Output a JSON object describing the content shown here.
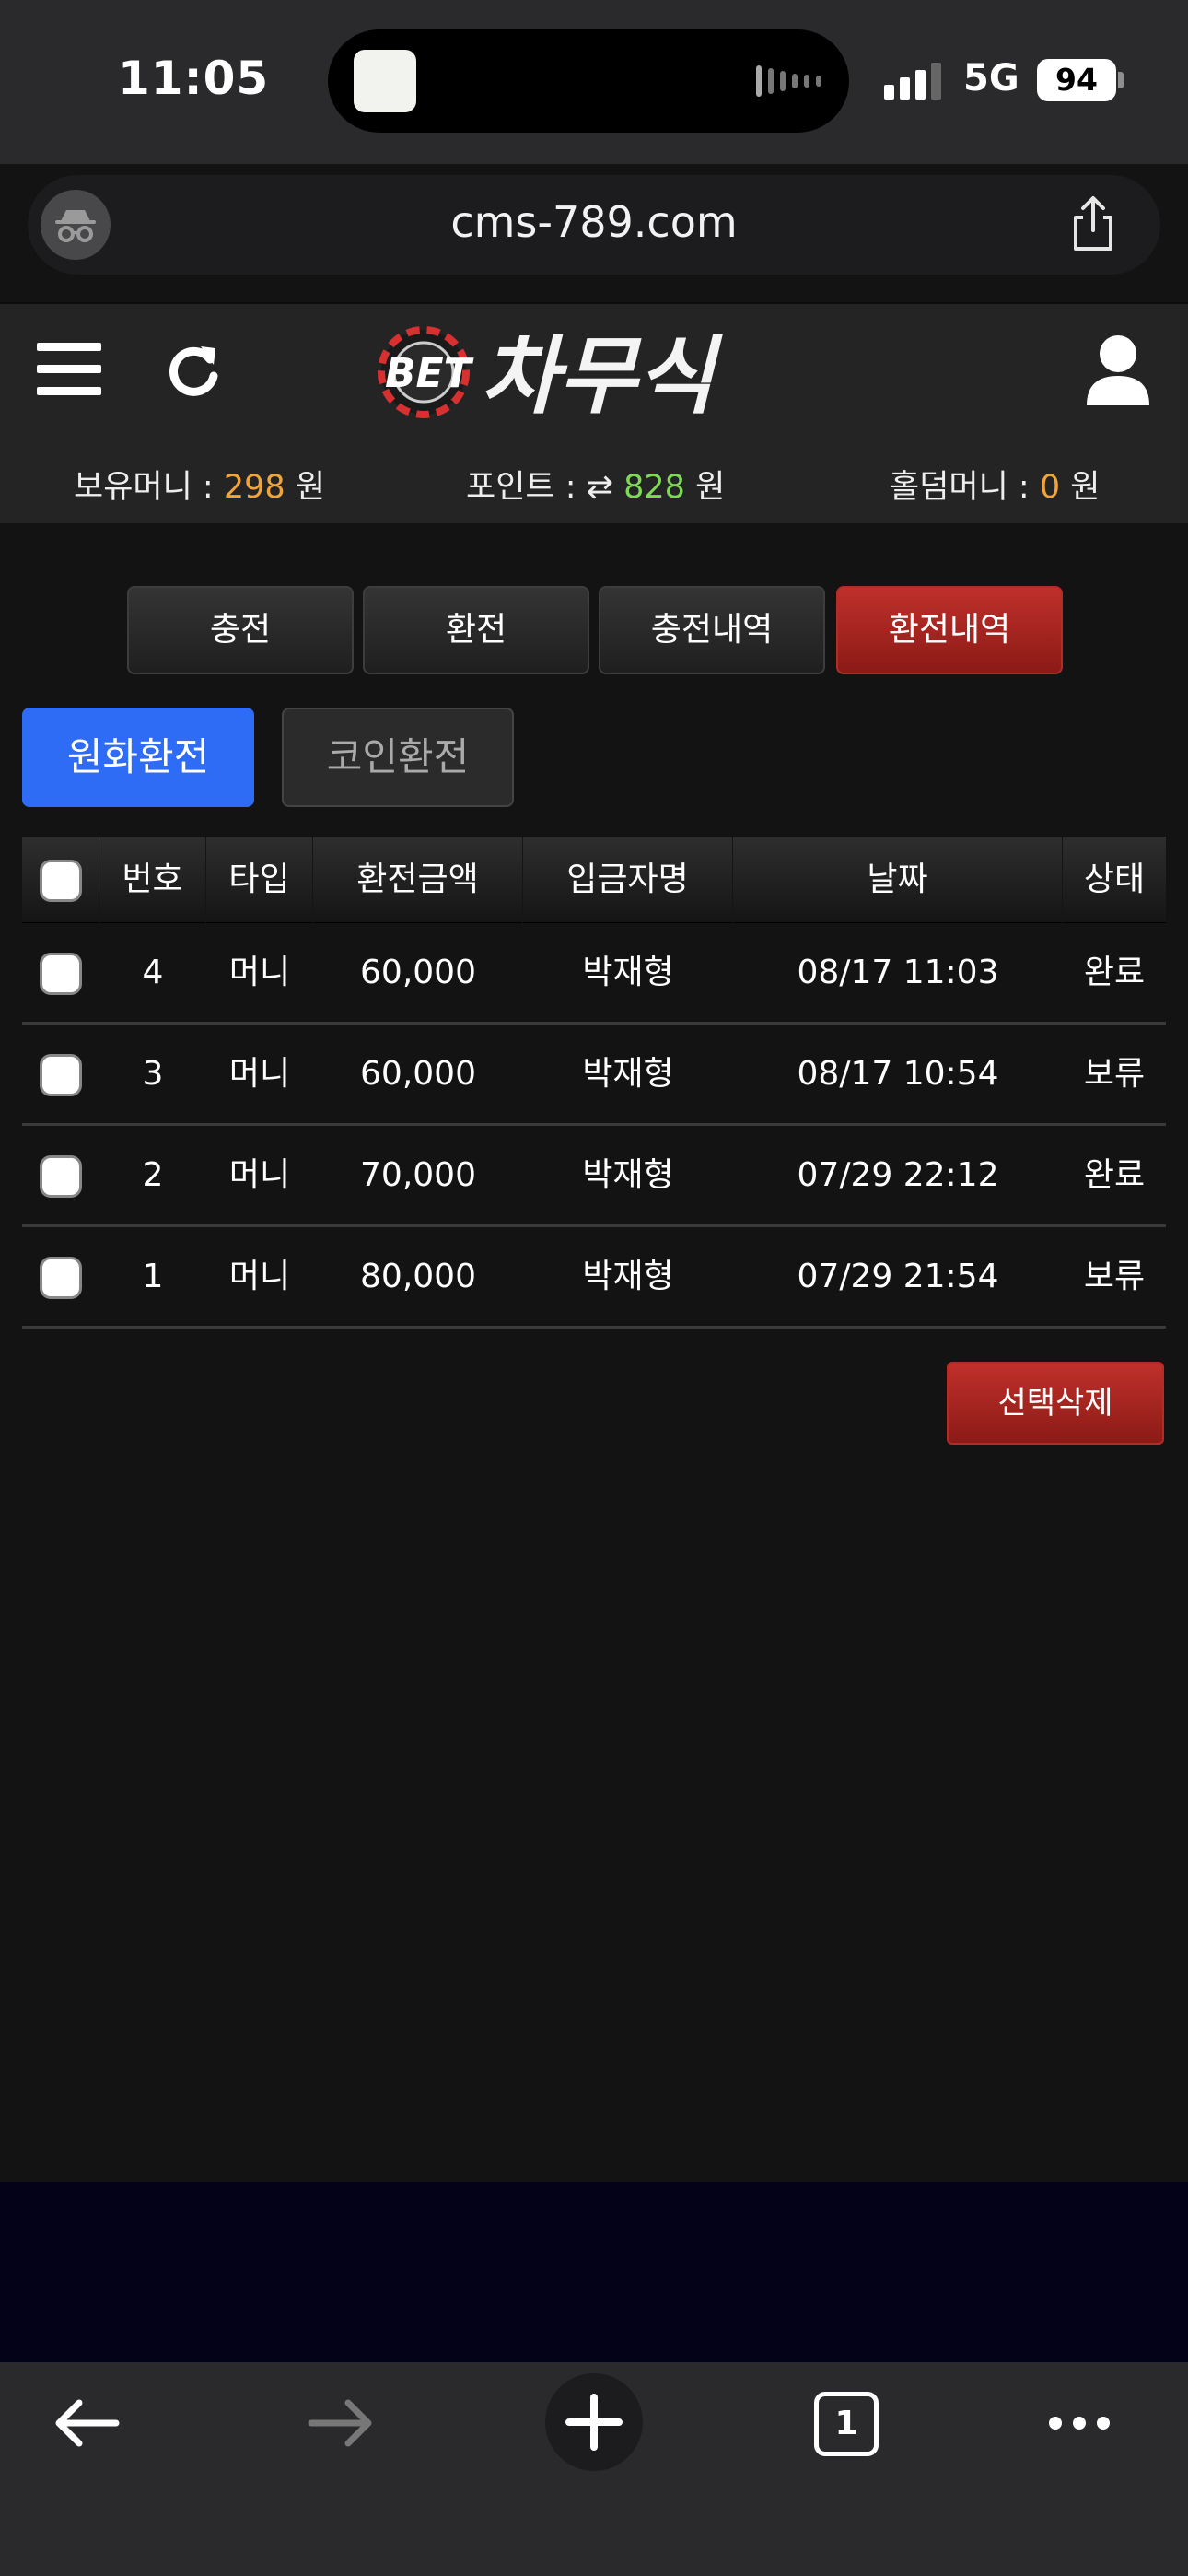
{
  "status": {
    "time": "11:05",
    "network": "5G",
    "battery": "94"
  },
  "browser": {
    "url": "cms-789.com",
    "tab_count": "1"
  },
  "header": {
    "logo_bet": "BET",
    "logo_name": "차무식",
    "balances": {
      "money_label": "보유머니 :",
      "money_value": "298",
      "money_unit": "원",
      "point_label": "포인트 :",
      "point_value": "828",
      "point_unit": "원",
      "holdem_label": "홀덤머니 :",
      "holdem_value": "0",
      "holdem_unit": "원"
    }
  },
  "nav_tabs": [
    "충전",
    "환전",
    "충전내역",
    "환전내역"
  ],
  "sub_tabs": [
    "원화환전",
    "코인환전"
  ],
  "table": {
    "headers": [
      "번호",
      "타입",
      "환전금액",
      "입금자명",
      "날짜",
      "상태"
    ],
    "rows": [
      {
        "no": "4",
        "type": "머니",
        "amount": "60,000",
        "name": "박재형",
        "date": "08/17 11:03",
        "status": "완료"
      },
      {
        "no": "3",
        "type": "머니",
        "amount": "60,000",
        "name": "박재형",
        "date": "08/17 10:54",
        "status": "보류"
      },
      {
        "no": "2",
        "type": "머니",
        "amount": "70,000",
        "name": "박재형",
        "date": "07/29 22:12",
        "status": "완료"
      },
      {
        "no": "1",
        "type": "머니",
        "amount": "80,000",
        "name": "박재형",
        "date": "07/29 21:54",
        "status": "보류"
      }
    ]
  },
  "delete_button": "선택삭제",
  "colors": {
    "accent_red": "#b32c26",
    "accent_blue": "#2f6cf5",
    "money_orange": "#f0a43a",
    "point_green": "#7ed957"
  }
}
